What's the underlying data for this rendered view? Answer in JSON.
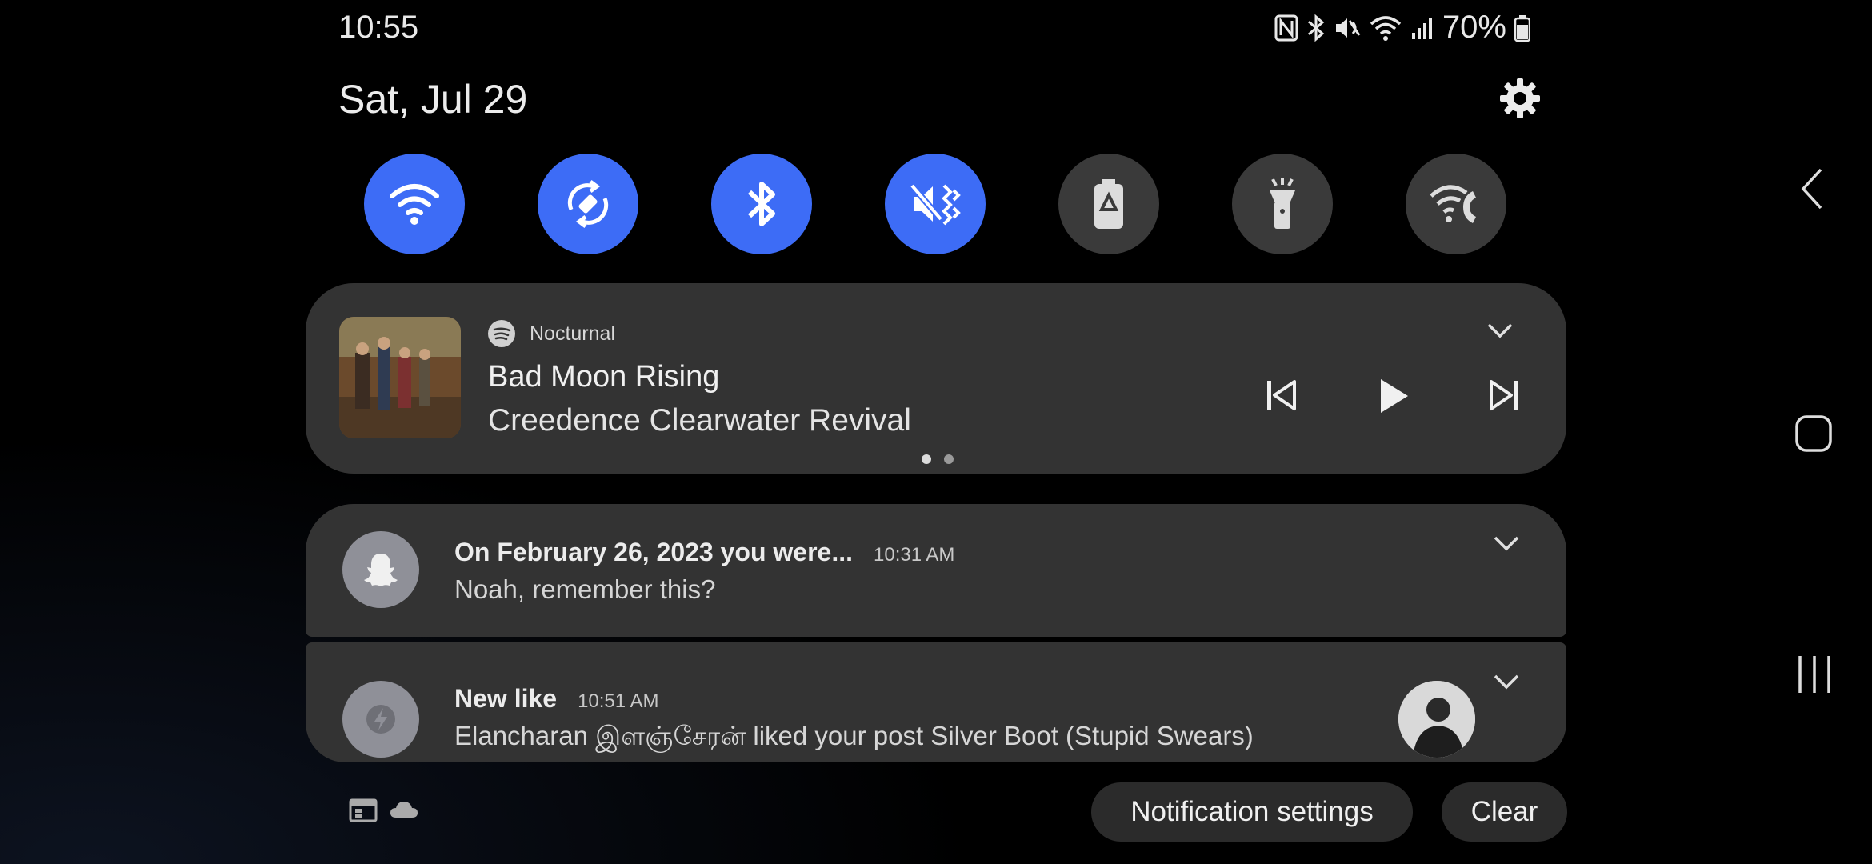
{
  "status_bar": {
    "time": "10:55",
    "battery": "70%",
    "icons": [
      "nfc-icon",
      "bluetooth-icon",
      "mute-icon",
      "wifi-icon",
      "signal-icon",
      "battery-icon"
    ]
  },
  "header": {
    "date": "Sat, Jul 29",
    "settings_icon": "gear-icon"
  },
  "quick_settings": [
    {
      "name": "wifi",
      "icon": "wifi-icon",
      "state": "on"
    },
    {
      "name": "auto-rotate",
      "icon": "rotate-icon",
      "state": "on"
    },
    {
      "name": "bluetooth",
      "icon": "bluetooth-icon",
      "state": "on"
    },
    {
      "name": "sound",
      "icon": "vibrate-mute-icon",
      "state": "on"
    },
    {
      "name": "power-saving",
      "icon": "battery-saver-icon",
      "state": "off"
    },
    {
      "name": "flashlight",
      "icon": "flashlight-icon",
      "state": "off"
    },
    {
      "name": "wifi-calling",
      "icon": "wifi-call-icon",
      "state": "off"
    }
  ],
  "media": {
    "app": "Nocturnal",
    "title": "Bad Moon Rising",
    "artist": "Creedence Clearwater Revival"
  },
  "notifications": [
    {
      "app_icon": "snapchat-icon",
      "title": "On February 26, 2023 you were...",
      "time": "10:31 AM",
      "body": "Noah, remember this?"
    },
    {
      "app_icon": "tinder-like-icon",
      "title": "New like",
      "time": "10:51 AM",
      "body": "Elancharan இளஞ்சேரன் liked your post Silver Boot (Stupid Swears)"
    }
  ],
  "footer": {
    "notification_settings_label": "Notification settings",
    "clear_label": "Clear"
  },
  "colors": {
    "accent": "#3d6cf6",
    "card": "#333333",
    "off_tile": "#3a3a3a"
  }
}
